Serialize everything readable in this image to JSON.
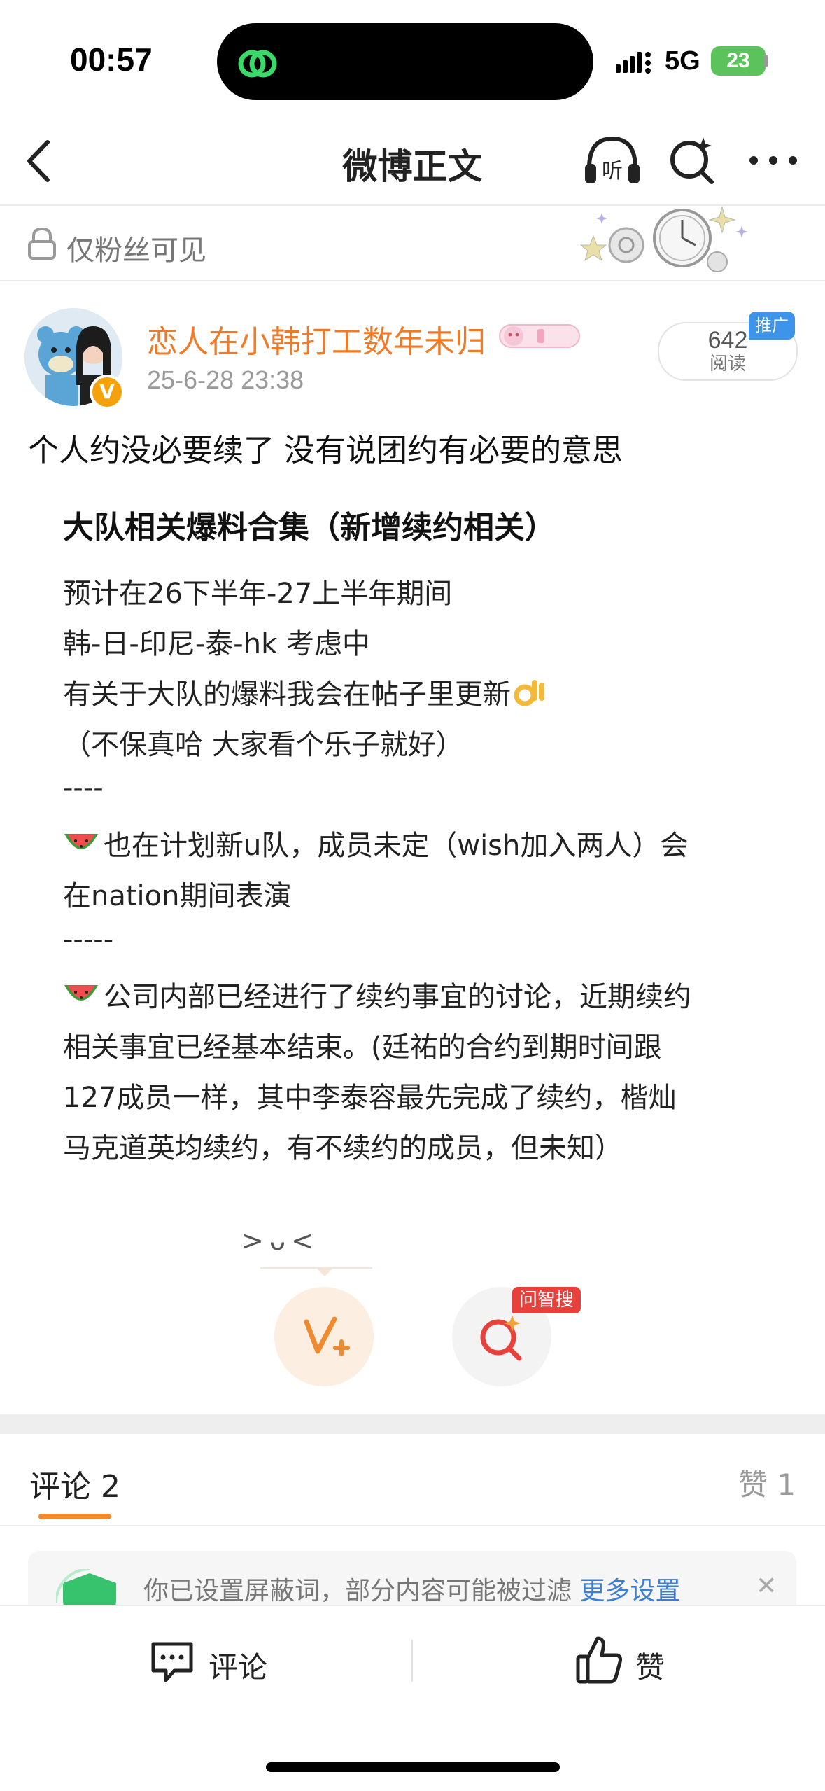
{
  "status_bar": {
    "time": "00:57",
    "network": "5G",
    "battery": "23"
  },
  "nav": {
    "title": "微博正文"
  },
  "visibility": {
    "label": "仅粉丝可见"
  },
  "author": {
    "name": "恋人在小韩打工数年未归",
    "time": "25-6-28 23:38",
    "verified_mark": "V"
  },
  "reads": {
    "count": "642",
    "label": "阅读",
    "promo_tag": "推广"
  },
  "post": {
    "text": "个人约没必要续了 没有说团约有必要的意思",
    "image": {
      "title": "大队相关爆料合集（新增续约相关）",
      "lines": [
        "预计在26下半年-27上半年期间",
        "韩-日-印尼-泰-hk 考虑中",
        "有关于大队的爆料我会在帖子里更新",
        "（不保真哈 大家看个乐子就好）",
        "----",
        "也在计划新u队，成员未定（wish加入两人）会",
        "在nation期间表演",
        "-----",
        "公司内部已经进行了续约事宜的讨论，近期续约",
        "相关事宜已经基本结束。(廷祐的合约到期时间跟",
        "127成员一样，其中李泰容最先完成了续约，楷灿",
        "马克道英均续约，有不续约的成员，但未知）"
      ],
      "emojis": [
        "ok-hand-emoji",
        "watermelon-emoji",
        "watermelon-emoji"
      ]
    },
    "kaomoji": ">ᴗ<"
  },
  "actions": {
    "ask_tag": "问智搜"
  },
  "comments": {
    "tab_label": "评论 2",
    "likes_label": "赞 1",
    "notice": "你已设置屏蔽词，部分内容可能被过滤",
    "notice_link": "更多设置"
  },
  "bottom_bar": {
    "comment_label": "评论",
    "like_label": "赞"
  },
  "colors": {
    "accent": "#f08a2f",
    "author": "#f07a25",
    "promo": "#3e94e8",
    "tag_red": "#e8403a"
  }
}
